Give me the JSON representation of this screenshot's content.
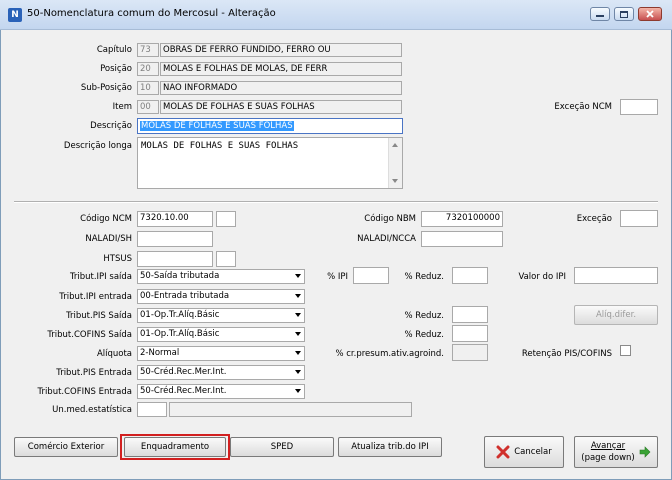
{
  "window": {
    "title": "50-Nomenclatura comum do Mercosul - Alteração",
    "app_icon": "app-logo-icon"
  },
  "labels": {
    "capitulo": "Capítulo",
    "posicao": "Posição",
    "sub_posicao": "Sub-Posição",
    "item": "Item",
    "descricao": "Descrição",
    "descricao_longa": "Descrição longa",
    "excecao_ncm": "Exceção NCM",
    "codigo_ncm": "Código NCM",
    "codigo_nbm": "Código NBM",
    "excecao": "Exceção",
    "naladi_sh": "NALADI/SH",
    "naladi_ncca": "NALADI/NCCA",
    "htsus": "HTSUS",
    "tribut_ipi_saida": "Tribut.IPI saída",
    "pct_ipi": "% IPI",
    "pct_reduz": "% Reduz.",
    "valor_ipi": "Valor do IPI",
    "tribut_ipi_entrada": "Tribut.IPI entrada",
    "tribut_pis_saida": "Tribut.PIS Saída",
    "tribut_cofins_saida": "Tribut.COFINS Saída",
    "aliquota": "Alíquota",
    "pct_cr_presum": "% cr.presum.ativ.agroind.",
    "retencao": "Retenção PIS/COFINS",
    "tribut_pis_entrada": "Tribut.PIS Entrada",
    "tribut_cofins_entrada": "Tribut.COFINS Entrada",
    "un_med": "Un.med.estatística"
  },
  "values": {
    "capitulo_code": "73",
    "capitulo_desc": "OBRAS DE FERRO FUNDIDO, FERRO OU",
    "posicao_code": "20",
    "posicao_desc": "MOLAS E FOLHAS DE MOLAS, DE FERR",
    "sub_posicao_code": "10",
    "sub_posicao_desc": "NAO INFORMADO",
    "item_code": "00",
    "item_desc": "MOLAS DE FOLHAS E SUAS FOLHAS",
    "descricao": "MOLAS DE FOLHAS E SUAS FOLHAS",
    "descricao_longa": "MOLAS DE FOLHAS E SUAS FOLHAS",
    "codigo_ncm": "7320.10.00",
    "codigo_nbm": "7320100000",
    "tribut_ipi_saida": "50-Saída tributada",
    "tribut_ipi_entrada": "00-Entrada tributada",
    "tribut_pis_saida": "01-Op.Tr.Alíq.Básic",
    "tribut_cofins_saida": "01-Op.Tr.Alíq.Básic",
    "aliquota": "2-Normal",
    "tribut_pis_entrada": "50-Créd.Rec.Mer.Int.",
    "tribut_cofins_entrada": "50-Créd.Rec.Mer.Int."
  },
  "buttons": {
    "aliq_difer": "Alíq.difer.",
    "comercio_exterior": "Comércio Exterior",
    "enquadramento": "Enquadramento",
    "sped": "SPED",
    "atualiza_trib": "Atualiza trib.do IPI",
    "cancelar": "Cancelar",
    "avancar": "Avançar",
    "avancar_hint": "(page down)"
  },
  "colors": {
    "selection": "#3399ff",
    "highlight_border": "#d22020",
    "cancel_icon": "#d0302c",
    "next_icon": "#3aa335"
  }
}
